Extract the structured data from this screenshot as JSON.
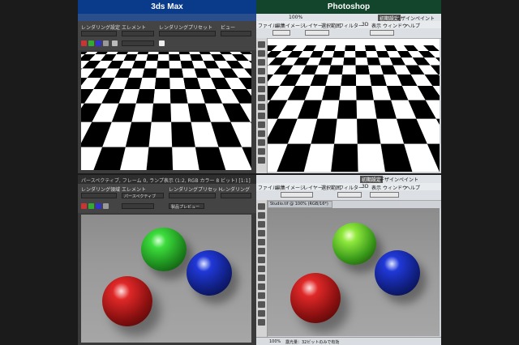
{
  "headers": {
    "left": "3ds Max",
    "right": "Photoshop",
    "left_color": "#0a3a8a",
    "right_color": "#12452b"
  },
  "colorchecker": [
    "#7a5a4a",
    "#c8957f",
    "#5f78a0",
    "#5c6b40",
    "#8a88b8",
    "#5fc0a9",
    "#d57a2c",
    "#4a5aa8",
    "#bf5568",
    "#5a3a6a",
    "#9fbf3a",
    "#e0a030",
    "#2f3a8f",
    "#3f8f3f",
    "#b0303a",
    "#e0c020",
    "#b8508f",
    "#1a88a8",
    "#f2f2f2",
    "#c8c8c8",
    "#a0a0a0",
    "#7a7a7a",
    "#555555",
    "#333333"
  ],
  "max_top": {
    "labels": [
      "レンダリング設定",
      "エレメント",
      "レンダリングプリセット",
      "ビュー"
    ]
  },
  "ps_top": {
    "menu": [
      "ファイル",
      "編集",
      "イメージ",
      "レイヤー",
      "選択範囲",
      "フィルター",
      "3D",
      "表示",
      "ウィンドウ",
      "ヘルプ"
    ],
    "zoom": "100%",
    "workspace": [
      "初期設定",
      "デザイン",
      "ペイント"
    ]
  },
  "max_bottom": {
    "title": "パースペクティブ, フレーム 0, ランプ表示 (1:2, RGB カラー 8 ビット) [1:1]",
    "labels": [
      "レンダリング領域",
      "エレメント",
      "レンダリングプリセット",
      "レンダリング"
    ],
    "preset": "パースペクティブ",
    "setting": "製品プレビュー"
  },
  "ps_bottom": {
    "menu": [
      "ファイル",
      "編集",
      "イメージ",
      "レイヤー",
      "選択範囲",
      "フィルター",
      "3D",
      "表示",
      "ウィンドウ",
      "ヘルプ"
    ],
    "workspace": [
      "初期設定",
      "デザイン",
      "ペイント"
    ],
    "doc_tab": "Studio.tif @ 100% (RGB/16*)",
    "status_zoom": "100%",
    "status_text": "露光量：32ビットのみで有効"
  },
  "spheres": {
    "green": "#3cdc3c",
    "blue": "#2038d8",
    "red": "#e02828"
  }
}
